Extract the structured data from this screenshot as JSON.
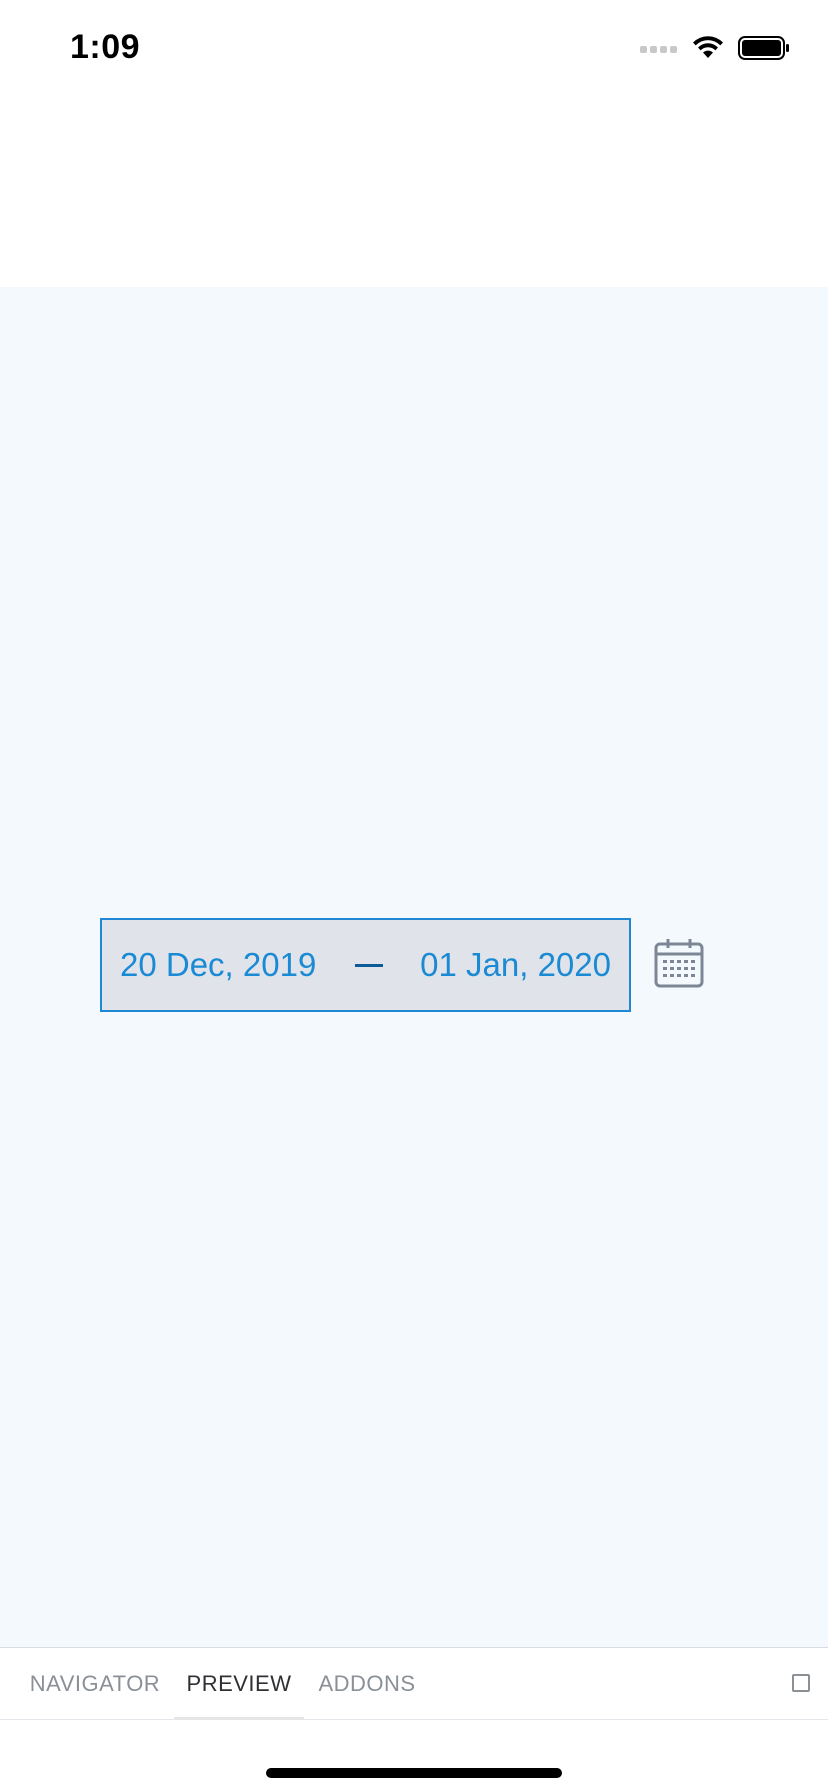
{
  "status_bar": {
    "time": "1:09",
    "icons": [
      "cellular-signal-icon",
      "wifi-icon",
      "battery-icon"
    ]
  },
  "date_range": {
    "start": "20 Dec, 2019",
    "end": "01 Jan, 2020",
    "icon": "calendar-icon",
    "colors": {
      "text": "#1a8ad4",
      "border": "#1e88d2",
      "background": "#e0e4ea",
      "dash": "#0d5a99"
    }
  },
  "canvas": {
    "background": "#f3f9fd"
  },
  "tabs": [
    {
      "label": "NAVIGATOR",
      "active": false
    },
    {
      "label": "PREVIEW",
      "active": true
    },
    {
      "label": "ADDONS",
      "active": false
    }
  ],
  "panel_toggle_icon": "square-panel-icon"
}
